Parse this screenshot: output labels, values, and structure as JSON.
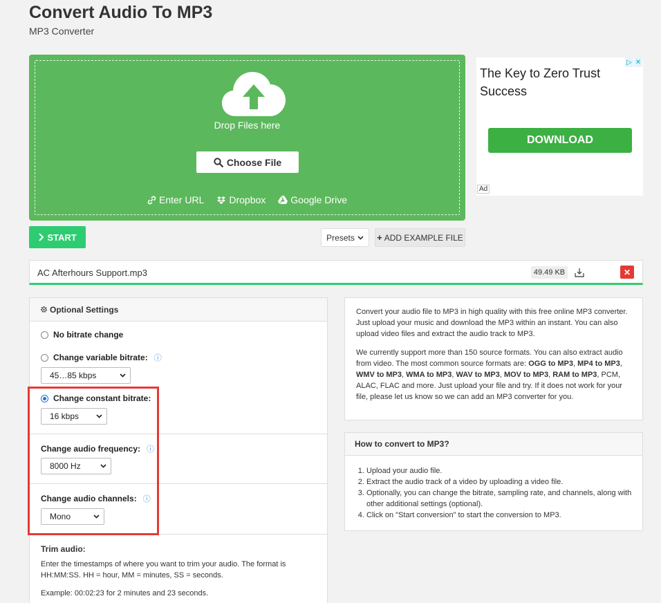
{
  "header": {
    "title": "Convert Audio To MP3",
    "subtitle": "MP3 Converter"
  },
  "dropzone": {
    "drop_text": "Drop Files here",
    "choose_label": "Choose File",
    "sources": [
      {
        "label": "Enter URL",
        "icon": "link-icon"
      },
      {
        "label": "Dropbox",
        "icon": "dropbox-icon"
      },
      {
        "label": "Google Drive",
        "icon": "google-drive-icon"
      }
    ]
  },
  "ad": {
    "title": "The Key to Zero Trust Success",
    "button": "DOWNLOAD",
    "tag": "Ad"
  },
  "toolbar": {
    "start_label": "START",
    "presets_label": "Presets",
    "example_label": "ADD EXAMPLE FILE"
  },
  "file": {
    "name": "AC Afterhours Support.mp3",
    "size": "49.49 KB"
  },
  "settings": {
    "heading": "Optional Settings",
    "no_bitrate": "No bitrate change",
    "variable_bitrate": "Change variable bitrate:",
    "variable_value": "45…85 kbps",
    "constant_bitrate": "Change constant bitrate:",
    "constant_value": "16 kbps",
    "frequency_label": "Change audio frequency:",
    "frequency_value": "8000 Hz",
    "channels_label": "Change audio channels:",
    "channels_value": "Mono",
    "trim_heading": "Trim audio:",
    "trim_text": "Enter the timestamps of where you want to trim your audio. The format is HH:MM:SS. HH = hour, MM = minutes, SS = seconds.",
    "trim_example": "Example: 00:02:23 for 2 minutes and 23 seconds."
  },
  "description": {
    "p1": "Convert your audio file to MP3 in high quality with this free online MP3 converter. Just upload your music and download the MP3 within an instant. You can also upload video files and extract the audio track to MP3.",
    "p2_start": "We currently support more than 150 source formats. You can also extract audio from video. The most common source formats are: ",
    "formats": [
      "OGG to MP3",
      "MP4 to MP3",
      "WMV to MP3",
      "WMA to MP3",
      "WAV to MP3",
      "MOV to MP3",
      "RAM to MP3"
    ],
    "p2_end": ", PCM, ALAC, FLAC and more. Just upload your file and try. If it does not work for your file, please let us know so we can add an MP3 converter for you."
  },
  "howto": {
    "heading": "How to convert to MP3?",
    "steps": [
      "Upload your audio file.",
      "Extract the audio track of a video by uploading a video file.",
      "Optionally, you can change the bitrate, sampling rate, and channels, along with other additional settings (optional).",
      "Click on \"Start conversion\" to start the conversion to MP3."
    ]
  },
  "colors": {
    "green": "#5cb85c",
    "start_green": "#2ecc71",
    "highlight_red": "#e53935",
    "ad_green": "#3cb043"
  }
}
